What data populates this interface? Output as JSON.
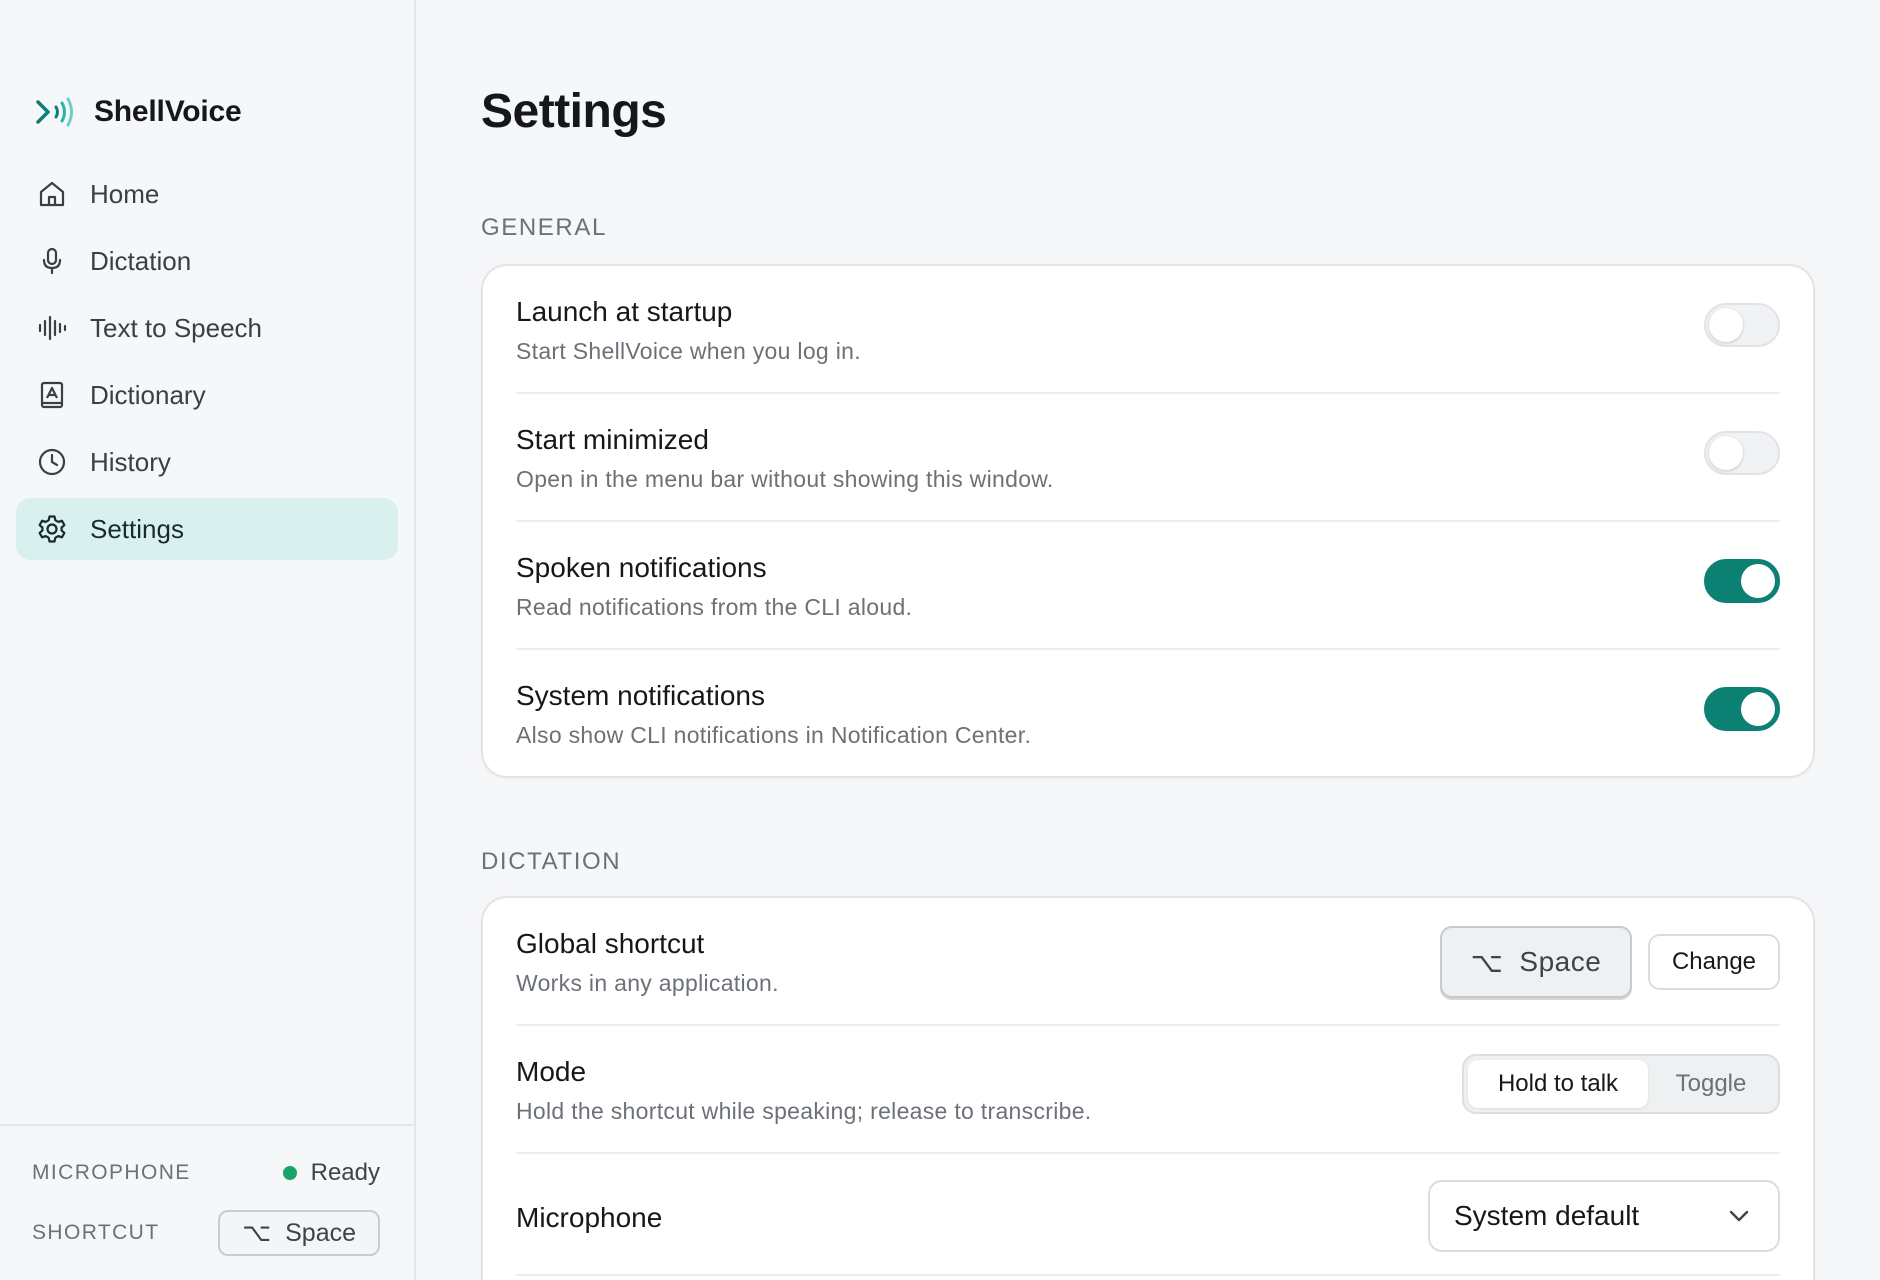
{
  "app": {
    "name": "ShellVoice"
  },
  "sidebar": {
    "items": [
      {
        "label": "Home",
        "icon": "home-icon",
        "active": false
      },
      {
        "label": "Dictation",
        "icon": "microphone-icon",
        "active": false
      },
      {
        "label": "Text to Speech",
        "icon": "waveform-icon",
        "active": false
      },
      {
        "label": "Dictionary",
        "icon": "book-icon",
        "active": false
      },
      {
        "label": "History",
        "icon": "clock-icon",
        "active": false
      },
      {
        "label": "Settings",
        "icon": "gear-icon",
        "active": true
      }
    ],
    "footer": {
      "microphone_label": "MICROPHONE",
      "microphone_status": "Ready",
      "shortcut_label": "SHORTCUT",
      "shortcut_symbol": "⌥",
      "shortcut_key": "Space"
    }
  },
  "main": {
    "title": "Settings",
    "general": {
      "label": "GENERAL",
      "rows": [
        {
          "title": "Launch at startup",
          "desc": "Start ShellVoice when you log in.",
          "enabled": false
        },
        {
          "title": "Start minimized",
          "desc": "Open in the menu bar without showing this window.",
          "enabled": false
        },
        {
          "title": "Spoken notifications",
          "desc": "Read notifications from the CLI aloud.",
          "enabled": true
        },
        {
          "title": "System notifications",
          "desc": "Also show CLI notifications in Notification Center.",
          "enabled": true
        }
      ]
    },
    "dictation": {
      "label": "DICTATION",
      "shortcut": {
        "title": "Global shortcut",
        "desc": "Works in any application.",
        "symbol": "⌥",
        "key": "Space",
        "change_label": "Change"
      },
      "mode": {
        "title": "Mode",
        "desc": "Hold the shortcut while speaking; release to transcribe.",
        "options": [
          "Hold to talk",
          "Toggle"
        ],
        "selected": "Hold to talk"
      },
      "microphone": {
        "title": "Microphone",
        "selected": "System default"
      }
    }
  },
  "colors": {
    "accent": "#0d8074",
    "active_nav_bg": "#d9f1ee",
    "status_ready": "#1aa368",
    "background": "#f6f7f8"
  }
}
